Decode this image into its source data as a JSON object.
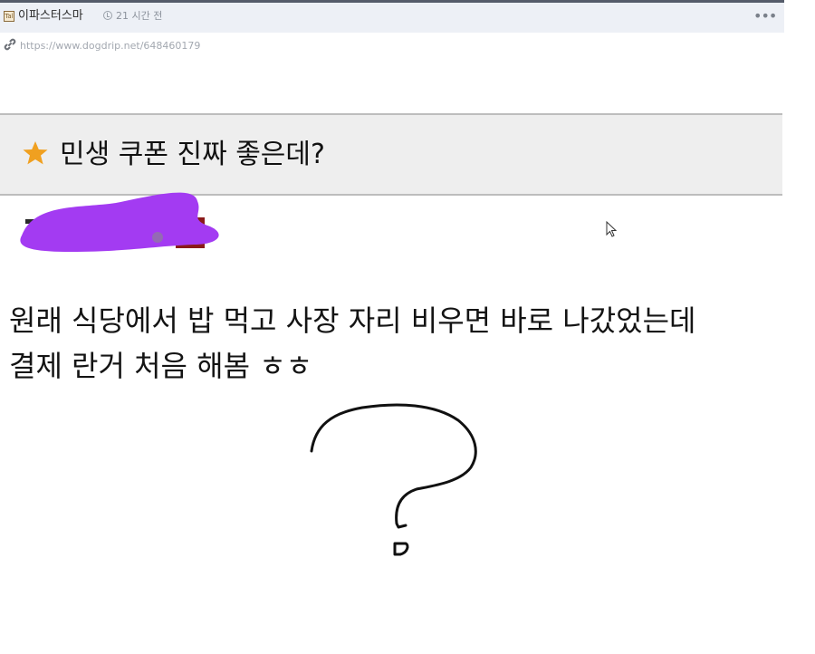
{
  "post": {
    "board_icon_text": "Tal",
    "author": "이파스터스마",
    "time_ago": "21 시간 전",
    "more_label": "•••",
    "url": "https://www.dogdrip.net/648460179",
    "title": "민생 쿠폰 진짜 좋은데?",
    "body_lines": [
      "원래 식당에서 밥 먹고 사장 자리 비우면 바로 나갔었는데",
      "결제 란거 처음 해봄 ㅎㅎ"
    ]
  },
  "colors": {
    "header_bg": "#edf0f6",
    "title_bg": "#eeeeee",
    "star": "#f0a020",
    "redaction": "#a33bf2"
  },
  "icons": {
    "board": "board-icon",
    "clock": "clock-icon",
    "more": "more-options-icon",
    "link": "link-icon",
    "star": "star-icon",
    "cursor": "mouse-cursor-icon"
  }
}
